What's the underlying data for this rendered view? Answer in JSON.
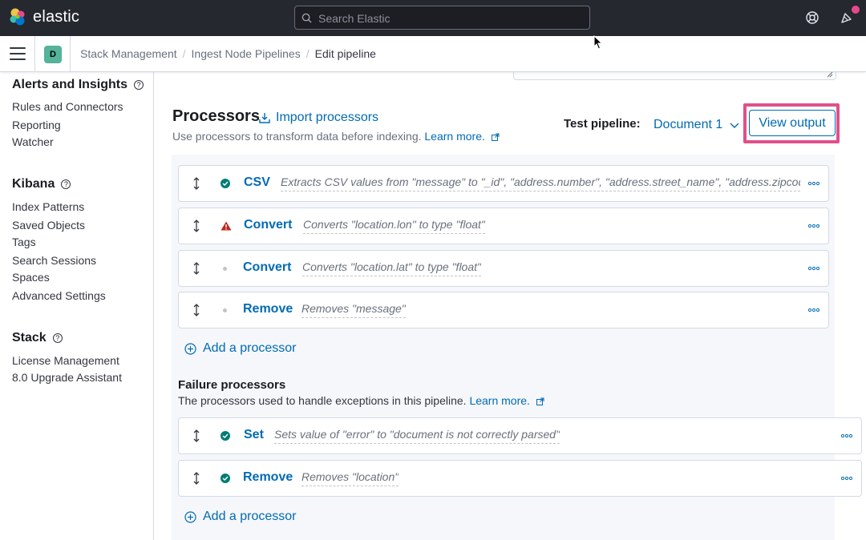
{
  "header": {
    "brand": "elastic",
    "search_placeholder": "Search Elastic",
    "icons": [
      "elastic-logo",
      "search-icon",
      "help-icon",
      "newsfeed-icon"
    ]
  },
  "breadcrumb": {
    "space_initial": "D",
    "items": [
      "Stack Management",
      "Ingest Node Pipelines",
      "Edit pipeline"
    ]
  },
  "sidebar": {
    "groups": [
      {
        "title": "Alerts and Insights",
        "items": [
          "Rules and Connectors",
          "Reporting",
          "Watcher"
        ]
      },
      {
        "title": "Kibana",
        "items": [
          "Index Patterns",
          "Saved Objects",
          "Tags",
          "Search Sessions",
          "Spaces",
          "Advanced Settings"
        ]
      },
      {
        "title": "Stack",
        "items": [
          "License Management",
          "8.0 Upgrade Assistant"
        ]
      }
    ]
  },
  "processors": {
    "title": "Processors",
    "import_label": "Import processors",
    "description": "Use processors to transform data before indexing.",
    "learn_more": "Learn more.",
    "test_pipeline_label": "Test pipeline:",
    "document_select": "Document 1",
    "view_output_label": "View output",
    "items": [
      {
        "name": "CSV",
        "status": "success",
        "detail": "Extracts CSV values from \"message\" to \"_id\", \"address.number\", \"address.street_name\", \"address.zipcode\","
      },
      {
        "name": "Convert",
        "status": "error",
        "detail": "Converts \"location.lon\" to type \"float\""
      },
      {
        "name": "Convert",
        "status": "inactive",
        "detail": "Converts \"location.lat\" to type \"float\""
      },
      {
        "name": "Remove",
        "status": "inactive",
        "detail": "Removes \"message\""
      }
    ],
    "add_label": "Add a processor"
  },
  "failure_processors": {
    "title": "Failure processors",
    "description": "The processors used to handle exceptions in this pipeline.",
    "learn_more": "Learn more.",
    "items": [
      {
        "name": "Set",
        "status": "success",
        "detail": "Sets value of \"error\" to \"document is not correctly parsed\""
      },
      {
        "name": "Remove",
        "status": "success",
        "detail": "Removes \"location\""
      }
    ],
    "add_label": "Add a processor"
  },
  "colors": {
    "header_bg": "#25282f",
    "link": "#006bb4",
    "success": "#017d73",
    "danger": "#bd271e",
    "highlight": "#e0508a",
    "panel_bg": "#f5f7fa"
  }
}
